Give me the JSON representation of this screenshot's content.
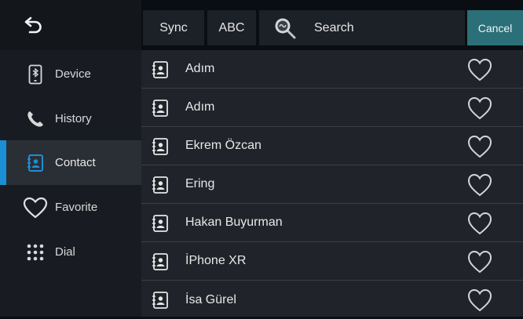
{
  "sidebar": {
    "back_icon": "back-arrow-icon",
    "items": [
      {
        "label": "Device",
        "icon": "phone-bluetooth-icon",
        "active": false
      },
      {
        "label": "History",
        "icon": "phone-handset-icon",
        "active": false
      },
      {
        "label": "Contact",
        "icon": "contact-book-icon",
        "active": true
      },
      {
        "label": "Favorite",
        "icon": "heart-icon",
        "active": false
      },
      {
        "label": "Dial",
        "icon": "dialpad-icon",
        "active": false
      }
    ]
  },
  "toolbar": {
    "sync_label": "Sync",
    "abc_label": "ABC",
    "search_label": "Search",
    "cancel_label": "Cancel"
  },
  "contacts": [
    {
      "name": "Adım"
    },
    {
      "name": "Adım"
    },
    {
      "name": "Ekrem Özcan"
    },
    {
      "name": "Ering"
    },
    {
      "name": "Hakan Buyurman"
    },
    {
      "name": "İPhone XR"
    },
    {
      "name": "İsa Gürel"
    }
  ],
  "colors": {
    "accent": "#1b8fd6",
    "cancel": "#2b6f78"
  }
}
